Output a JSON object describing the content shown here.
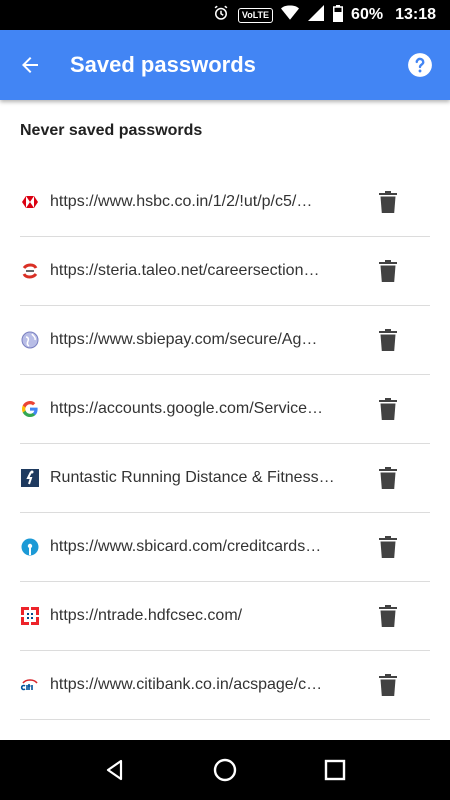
{
  "status_bar": {
    "volte": "VoLTE",
    "battery": "60%",
    "time": "13:18"
  },
  "app_bar": {
    "title": "Saved passwords",
    "back_icon": "arrow-back-icon",
    "help_icon": "help-icon",
    "color": "#4285f4"
  },
  "section": {
    "title": "Never saved passwords"
  },
  "entries": [
    {
      "label": "https://www.hsbc.co.in/1/2/!ut/p/c5/…",
      "icon": "hsbc-favicon"
    },
    {
      "label": "https://steria.taleo.net/careersection…",
      "icon": "taleo-favicon"
    },
    {
      "label": "https://www.sbiepay.com/secure/Ag…",
      "icon": "globe-favicon"
    },
    {
      "label": "https://accounts.google.com/Service…",
      "icon": "google-favicon"
    },
    {
      "label": "Runtastic Running Distance & Fitness…",
      "icon": "runtastic-favicon"
    },
    {
      "label": "https://www.sbicard.com/creditcards…",
      "icon": "sbi-favicon"
    },
    {
      "label": "https://ntrade.hdfcsec.com/",
      "icon": "hdfc-favicon"
    },
    {
      "label": "https://www.citibank.co.in/acspage/c…",
      "icon": "citi-favicon"
    }
  ],
  "delete_icon": "trash-icon",
  "nav_bar": {
    "back": "nav-back-icon",
    "home": "nav-home-icon",
    "recents": "nav-recents-icon"
  }
}
